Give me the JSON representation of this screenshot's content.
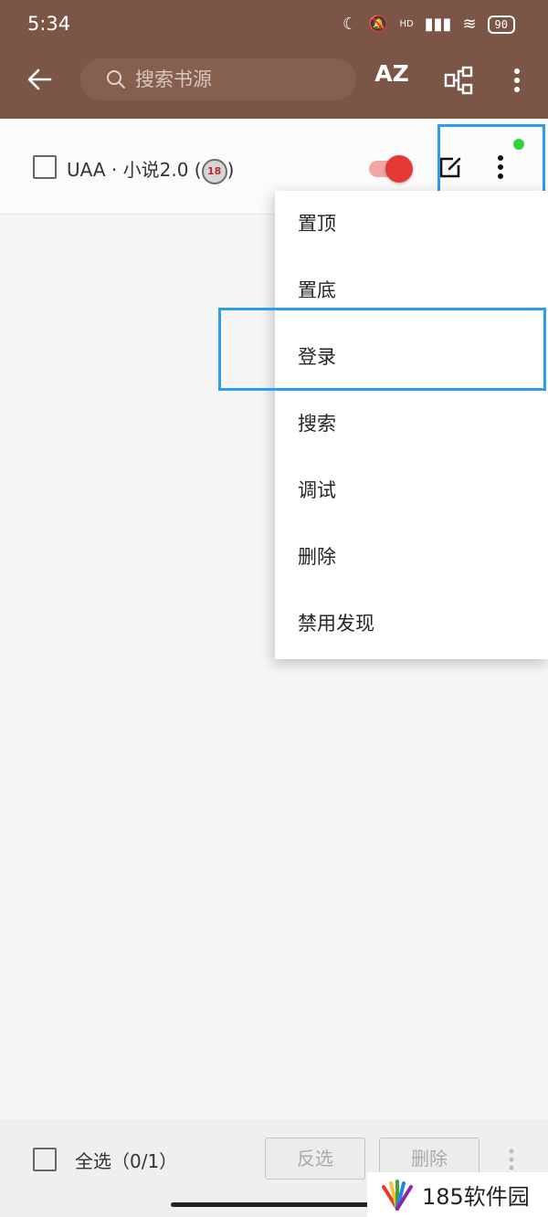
{
  "status_bar": {
    "time": "5:34",
    "battery": "90",
    "network": "HD"
  },
  "toolbar": {
    "back_icon": "arrow-left-icon",
    "search_placeholder": "搜索书源",
    "sort_label": "AZ",
    "group_icon": "group-icon",
    "more_icon": "more-vertical-icon"
  },
  "source": {
    "name": "UAA · 小说2.0 (",
    "badge": "18",
    "name_suffix": ")",
    "enabled": true
  },
  "menu": {
    "items": [
      "置顶",
      "置底",
      "登录",
      "搜索",
      "调试",
      "删除",
      "禁用发现"
    ]
  },
  "bottom": {
    "select_all": "全选（0/1）",
    "invert": "反选",
    "delete": "删除"
  },
  "watermark": {
    "text": "185软件园"
  },
  "colors": {
    "appbar": "#7b5647",
    "accent": "#e53935",
    "highlight": "#2d9cea"
  }
}
